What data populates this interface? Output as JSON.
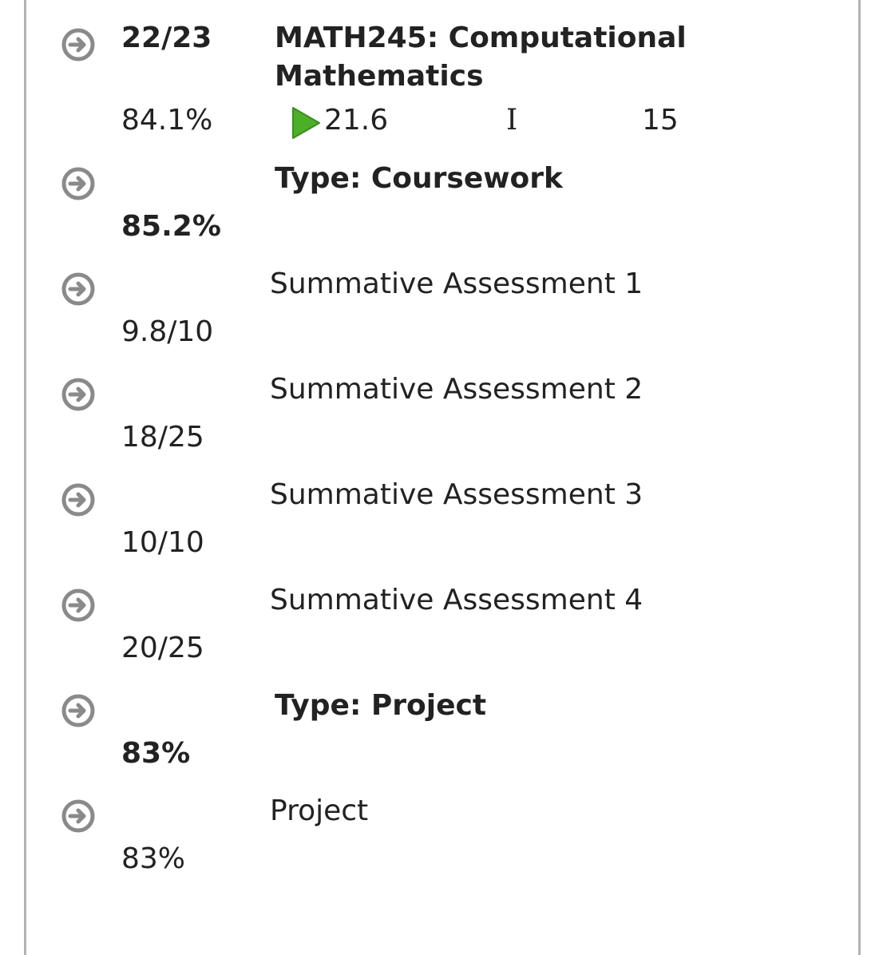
{
  "course": {
    "term": "22/23",
    "title_line1": "MATH245: Computational",
    "title_line2": "Mathematics",
    "percent": "84.1%",
    "trend_value": "21.6",
    "grade": "I",
    "credits": "15",
    "trend_color": "#4caf28"
  },
  "rows": [
    {
      "label": "Type: Coursework",
      "value": "85.2%",
      "bold": true
    },
    {
      "label": "Summative Assessment 1",
      "value": "9.8/10",
      "bold": false
    },
    {
      "label": "Summative Assessment 2",
      "value": "18/25",
      "bold": false
    },
    {
      "label": "Summative Assessment 3",
      "value": "10/10",
      "bold": false
    },
    {
      "label": "Summative Assessment 4",
      "value": "20/25",
      "bold": false
    },
    {
      "label": "Type: Project",
      "value": "83%",
      "bold": true
    },
    {
      "label": "Project",
      "value": "83%",
      "bold": false
    }
  ],
  "icons": {
    "row_icon": "arrow-right-circle-icon",
    "trend_icon": "play-triangle-icon"
  }
}
